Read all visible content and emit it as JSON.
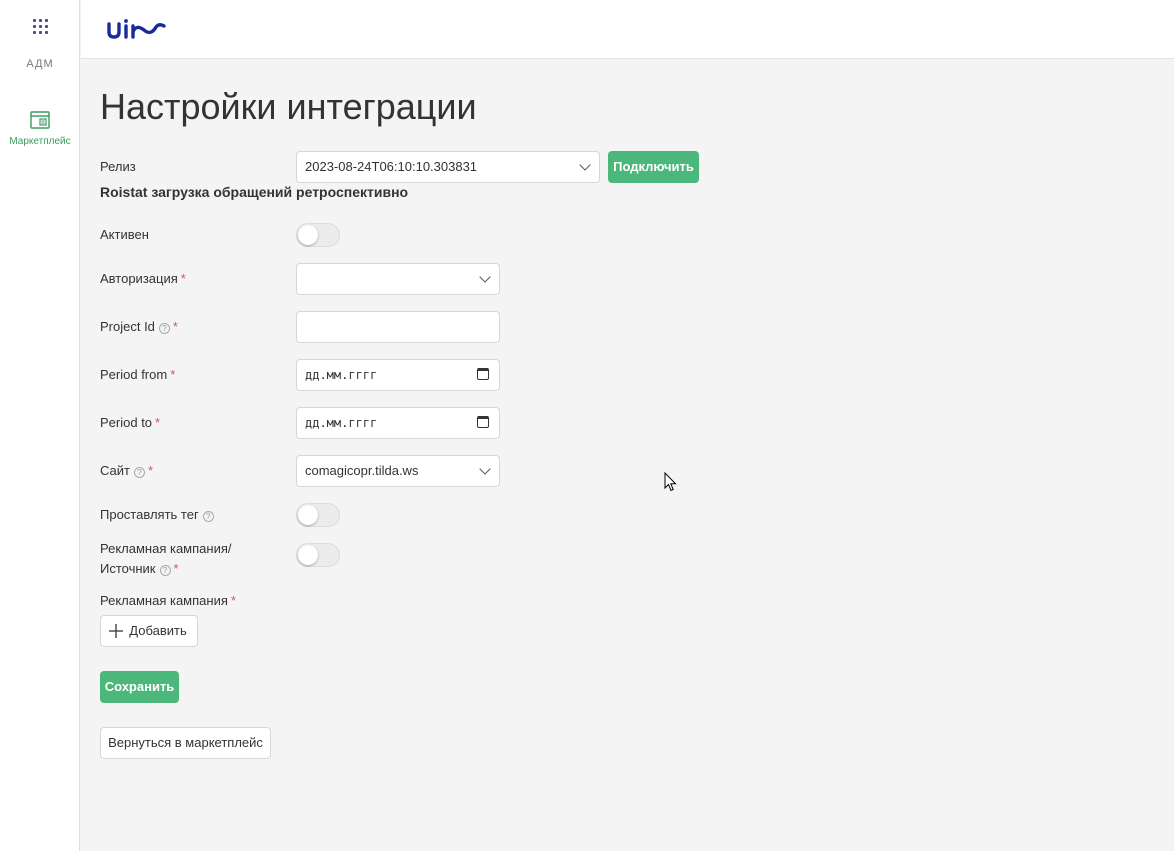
{
  "sidebar": {
    "adm_label": "АДМ",
    "marketplace_label": "Маркетплейс"
  },
  "page": {
    "title": "Настройки интеграции"
  },
  "release": {
    "label": "Релиз",
    "value": "2023-08-24T06:10:10.303831",
    "connect_button": "Подключить"
  },
  "section": {
    "title": "Roistat загрузка обращений ретроспективно"
  },
  "fields": {
    "active": {
      "label": "Активен"
    },
    "authorization": {
      "label": "Авторизация",
      "value": ""
    },
    "project_id": {
      "label": "Project Id",
      "value": ""
    },
    "period_from": {
      "label": "Period from",
      "placeholder": "дд.мм.гггг"
    },
    "period_to": {
      "label": "Period to",
      "placeholder": "дд.мм.гггг"
    },
    "site": {
      "label": "Сайт",
      "value": "comagicopr.tilda.ws"
    },
    "set_tag": {
      "label": "Проставлять тег"
    },
    "campaign_source": {
      "label_line1": "Рекламная кампания/",
      "label_line2": "Источник"
    },
    "campaign": {
      "label": "Рекламная кампания",
      "add_button": "Добавить"
    }
  },
  "actions": {
    "save": "Сохранить",
    "back": "Вернуться в маркетплейс"
  },
  "colors": {
    "accent_green": "#4cb77a",
    "required_red": "#d9534f",
    "logo_blue": "#1a2a9c"
  }
}
